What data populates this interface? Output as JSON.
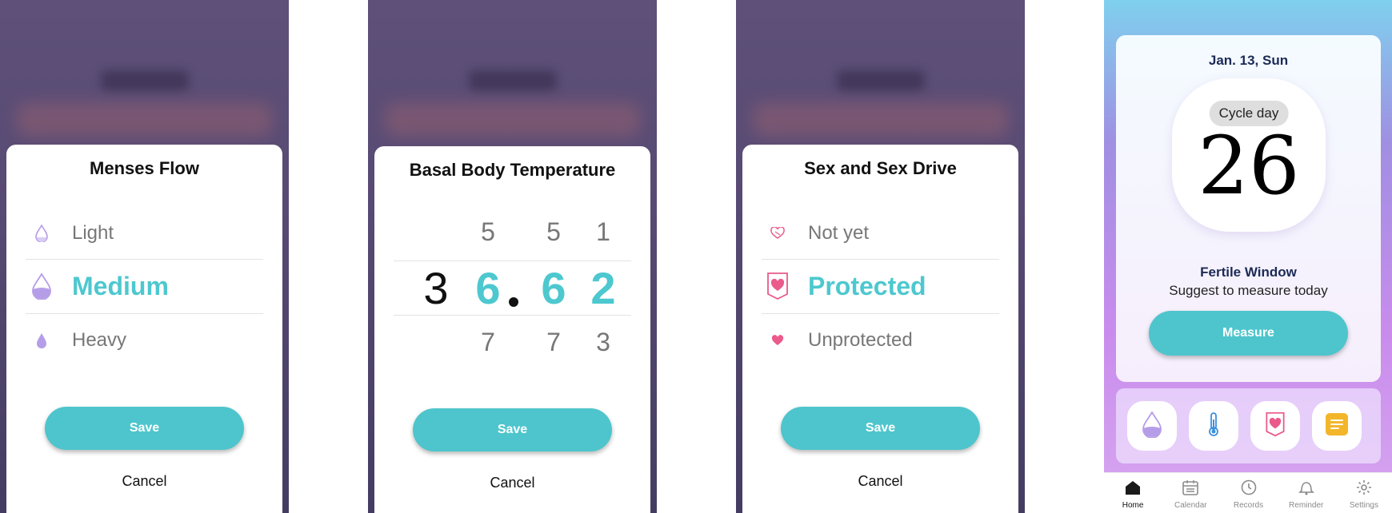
{
  "menses_flow": {
    "title": "Menses Flow",
    "options": [
      {
        "label": "Light",
        "icon": "light-drop-icon"
      },
      {
        "label": "Medium",
        "icon": "medium-drop-icon",
        "selected": true
      },
      {
        "label": "Heavy",
        "icon": "heavy-drop-icon"
      }
    ],
    "save_label": "Save",
    "cancel_label": "Cancel"
  },
  "temperature": {
    "title": "Basal Body Temperature",
    "above_digits": [
      "5",
      "5",
      "1"
    ],
    "current": {
      "integer_fixed": "3",
      "d1": "6",
      "separator": ".",
      "d2": "6",
      "d3": "2"
    },
    "below_digits": [
      "7",
      "7",
      "3"
    ],
    "save_label": "Save",
    "cancel_label": "Cancel"
  },
  "sex_drive": {
    "title": "Sex and Sex Drive",
    "options": [
      {
        "label": "Not yet",
        "icon": "heart-outline-icon"
      },
      {
        "label": "Protected",
        "icon": "shield-heart-icon",
        "selected": true
      },
      {
        "label": "Unprotected",
        "icon": "heart-icon"
      }
    ],
    "save_label": "Save",
    "cancel_label": "Cancel"
  },
  "home": {
    "date": "Jan. 13, Sun",
    "cycle_day_label": "Cycle day",
    "cycle_day": "26",
    "status_title": "Fertile Window",
    "status_subtitle": "Suggest to measure today",
    "measure_label": "Measure",
    "quick_actions": [
      "menses-drop-icon",
      "thermometer-icon",
      "shield-heart-icon",
      "notes-icon"
    ],
    "nav": [
      {
        "label": "Home",
        "icon": "home-icon",
        "active": true
      },
      {
        "label": "Calendar",
        "icon": "calendar-icon"
      },
      {
        "label": "Records",
        "icon": "clock-icon"
      },
      {
        "label": "Reminder",
        "icon": "bell-icon"
      },
      {
        "label": "Settings",
        "icon": "gear-icon"
      }
    ]
  },
  "colors": {
    "accent": "#4ec5cc",
    "selected_text": "#4dc8cf",
    "drop_purple": "#b69de8",
    "heart_pink": "#ea5a8a",
    "note_yellow": "#f3b62a"
  }
}
